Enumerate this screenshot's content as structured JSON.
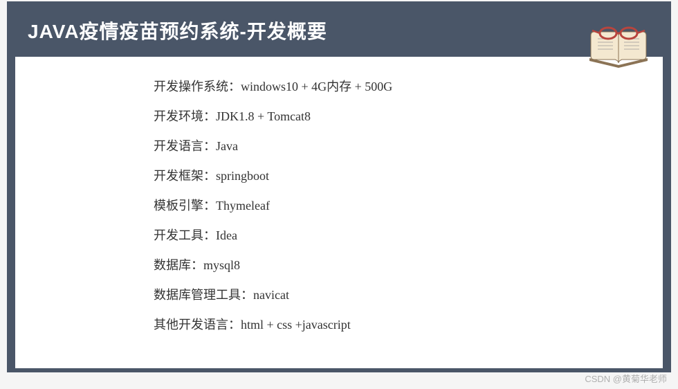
{
  "header": {
    "title": "JAVA疫情疫苗预约系统-开发概要"
  },
  "content": {
    "lines": [
      "开发操作系统：windows10 + 4G内存 + 500G",
      "开发环境：JDK1.8 + Tomcat8",
      "开发语言：Java",
      "开发框架：springboot",
      "模板引擎：Thymeleaf",
      "开发工具：Idea",
      "数据库：mysql8",
      "数据库管理工具：navicat",
      "其他开发语言：html + css +javascript"
    ]
  },
  "watermark": "CSDN @黄菊华老师"
}
